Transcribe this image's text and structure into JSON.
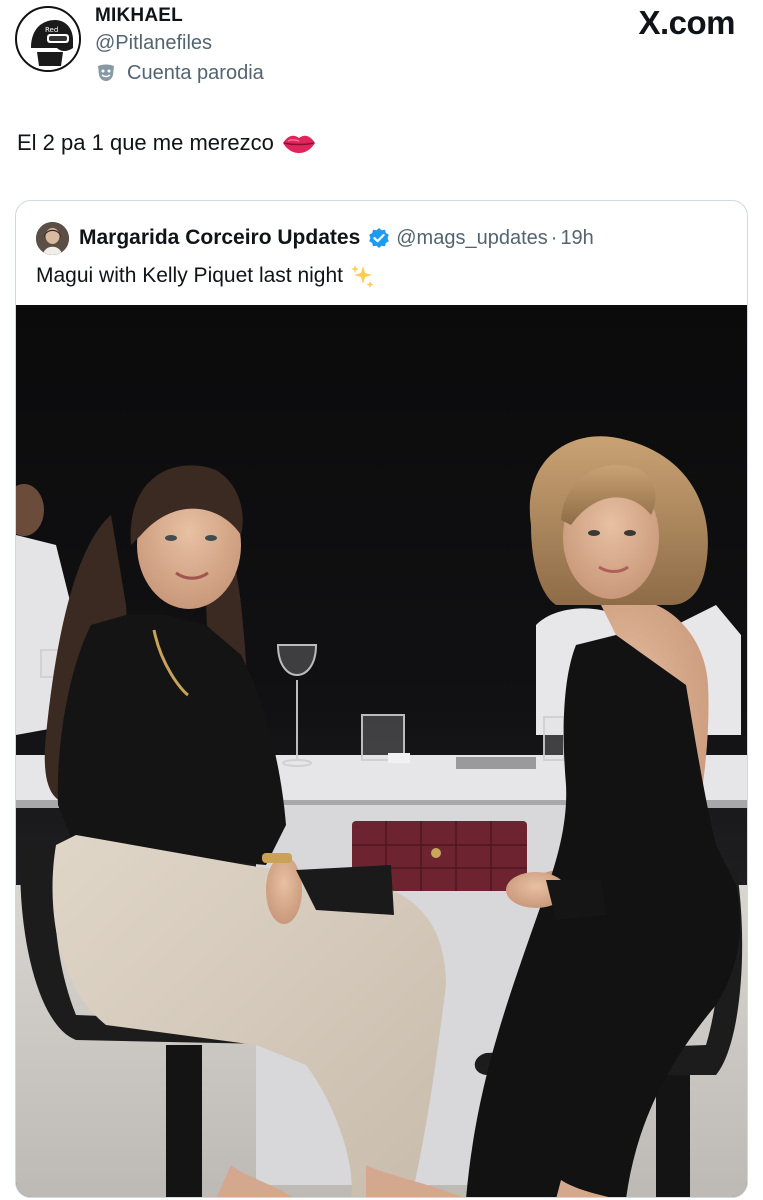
{
  "post": {
    "author_name": "MIKHAEL",
    "author_handle": "@Pitlanefiles",
    "parody_label": "Cuenta parodia",
    "avatar_icon": "helmet-avatar-icon",
    "text": "El 2 pa 1 que me merezco",
    "emoji_icon": "lips-icon"
  },
  "brand": {
    "label": "X.com"
  },
  "quote": {
    "author_name": "Margarida Corceiro Updates",
    "verified_icon": "verified-badge-icon",
    "handle": "@mags_updates",
    "separator": "·",
    "time": "19h",
    "text": "Magui with Kelly Piquet last night",
    "emoji_icon": "sparkles-icon",
    "verified_color": "#1d9bf0"
  },
  "photo": {
    "description_icon": "photo-image"
  }
}
